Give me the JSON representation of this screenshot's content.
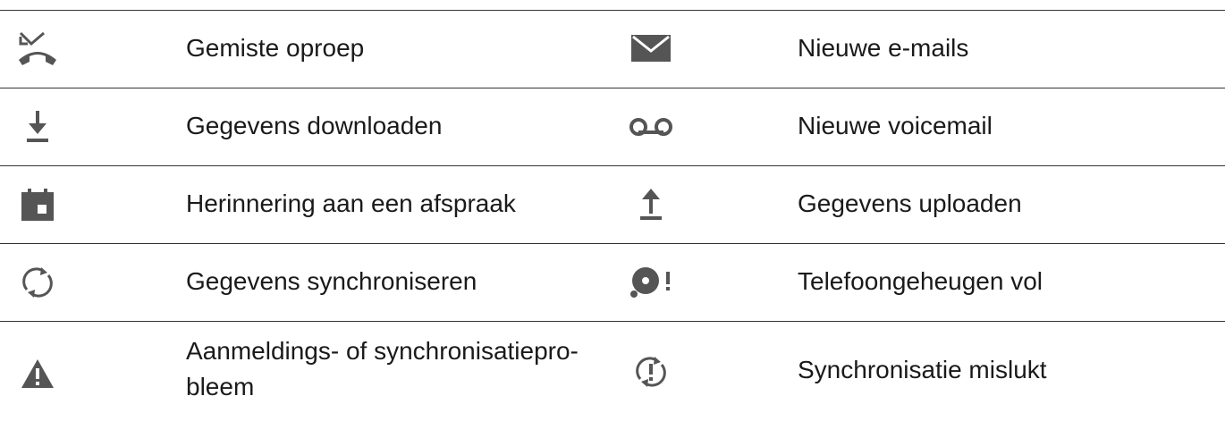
{
  "rows": [
    {
      "left": {
        "icon": "missed-call-icon",
        "label": "Gemiste oproep"
      },
      "right": {
        "icon": "email-icon",
        "label": "Nieuwe e-mails"
      }
    },
    {
      "left": {
        "icon": "download-icon",
        "label": "Gegevens downloaden"
      },
      "right": {
        "icon": "voicemail-icon",
        "label": "Nieuwe voicemail"
      }
    },
    {
      "left": {
        "icon": "calendar-icon",
        "label": "Herinnering aan een afspraak"
      },
      "right": {
        "icon": "upload-icon",
        "label": "Gegevens uploaden"
      }
    },
    {
      "left": {
        "icon": "sync-icon",
        "label": "Gegevens synchroniseren"
      },
      "right": {
        "icon": "storage-full-icon",
        "label": "Telefoongeheugen vol"
      }
    },
    {
      "left": {
        "icon": "warning-icon",
        "label": "Aanmeldings- of synchronisatiepro- bleem"
      },
      "right": {
        "icon": "sync-failed-icon",
        "label": "Synchronisatie mislukt"
      }
    }
  ],
  "colors": {
    "icon": "#555555",
    "text": "#1a1a1a",
    "rule": "#333333"
  }
}
